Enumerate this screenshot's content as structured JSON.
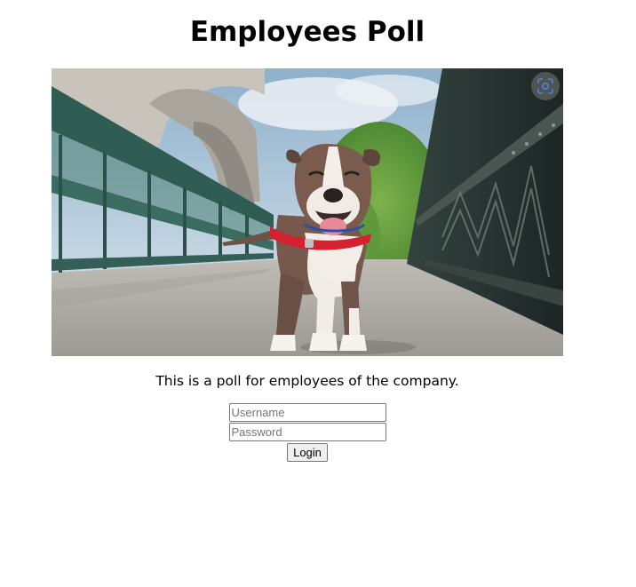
{
  "page": {
    "title": "Employees Poll",
    "description": "This is a poll for employees of the company."
  },
  "hero_image": {
    "subject": "smiling pit bull dog with red harness standing on a bridge",
    "lens_icon": "visual-search-icon"
  },
  "login": {
    "username_placeholder": "Username",
    "password_placeholder": "Password",
    "button_label": "Login"
  },
  "colors": {
    "background": "#ffffff",
    "text": "#000000",
    "harness_red": "#d4202f",
    "railing_green": "#3f6e63"
  }
}
